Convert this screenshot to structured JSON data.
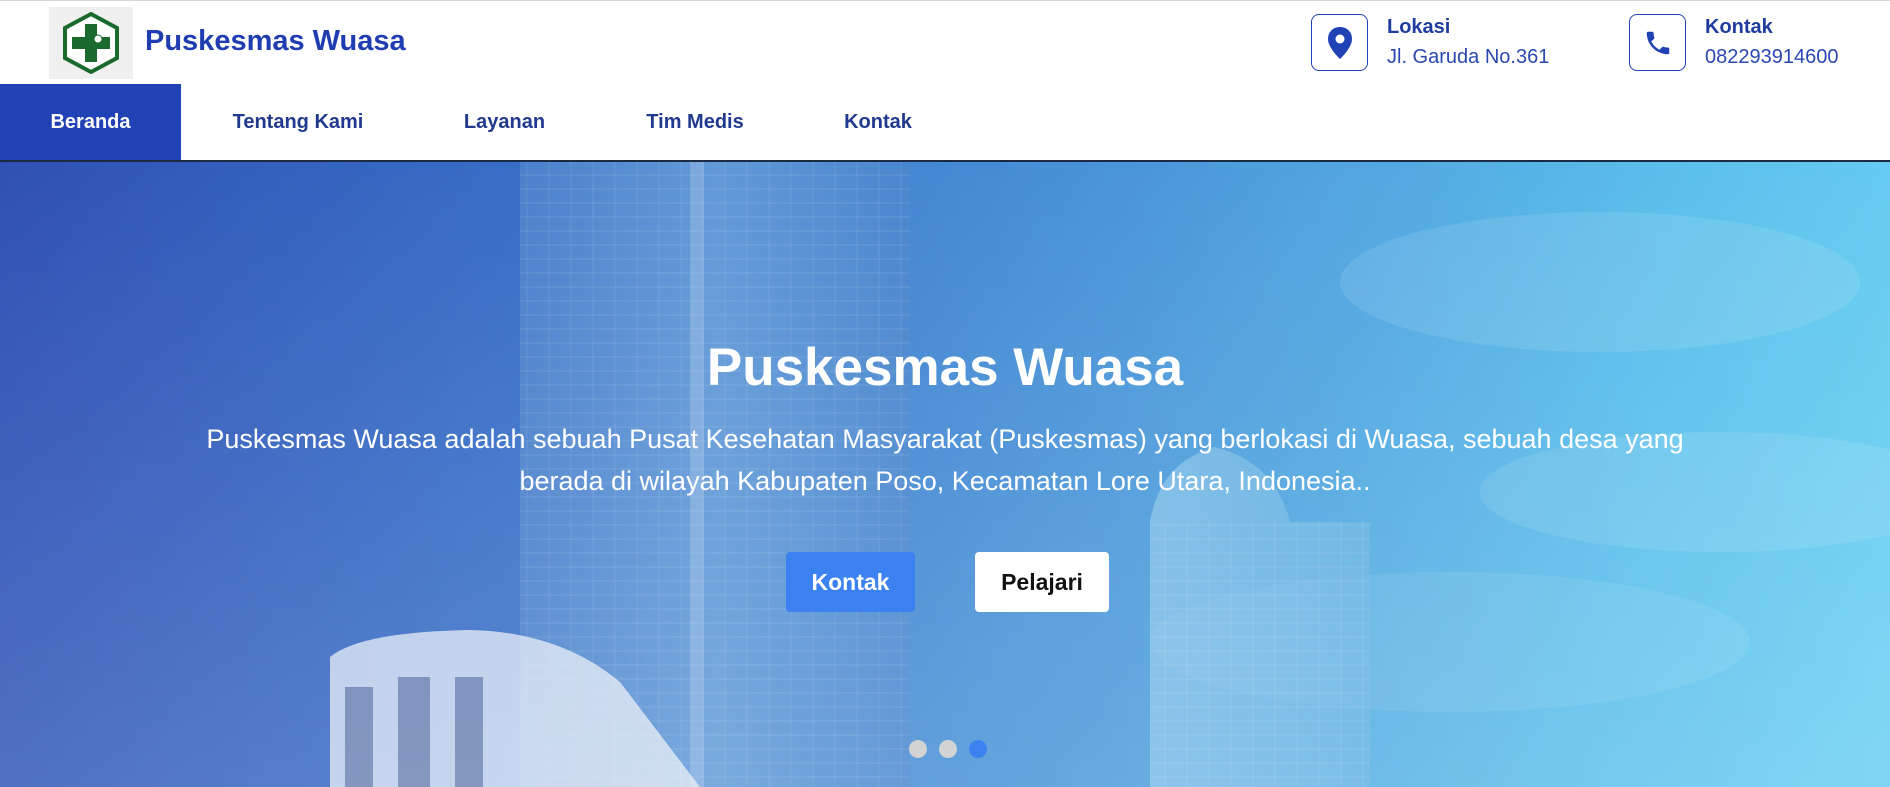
{
  "header": {
    "site_title": "Puskesmas Wuasa",
    "logo_icon": "puskesmas-cross-logo",
    "location": {
      "icon": "map-pin-icon",
      "label": "Lokasi",
      "value": "Jl. Garuda No.361"
    },
    "contact": {
      "icon": "phone-icon",
      "label": "Kontak",
      "value": "082293914600"
    }
  },
  "nav": {
    "items": [
      {
        "label": "Beranda",
        "active": true
      },
      {
        "label": "Tentang Kami",
        "active": false
      },
      {
        "label": "Layanan",
        "active": false
      },
      {
        "label": "Tim Medis",
        "active": false
      },
      {
        "label": "Kontak",
        "active": false
      }
    ]
  },
  "hero": {
    "title": "Puskesmas Wuasa",
    "description": "Puskesmas Wuasa adalah sebuah Pusat Kesehatan Masyarakat (Puskesmas) yang berlokasi di Wuasa, sebuah desa yang berada di wilayah Kabupaten Poso, Kecamatan Lore Utara, Indonesia..",
    "primary_button": "Kontak",
    "secondary_button": "Pelajari",
    "carousel": {
      "slides": 3,
      "active_index": 2
    }
  },
  "colors": {
    "brand": "#2142b5",
    "primary_button": "#3b82f0",
    "dot_active": "#3b82f0",
    "dot_inactive": "#d3d3d3"
  }
}
